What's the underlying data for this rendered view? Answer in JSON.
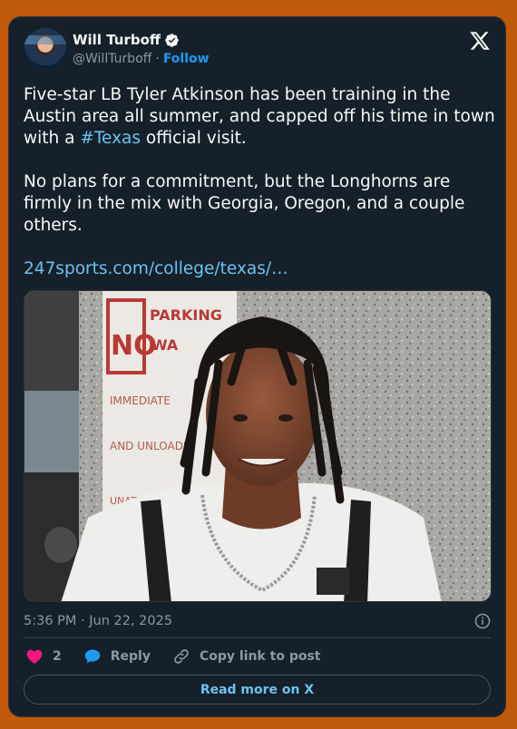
{
  "author": {
    "name": "Will Turboff",
    "handle": "@WillTurboff",
    "separator": "·",
    "follow_label": "Follow"
  },
  "tweet": {
    "para1_pre": "Five-star LB Tyler Atkinson has been training in the Austin area all summer, and capped off his time in town with a ",
    "hashtag": "#Texas",
    "para1_post": " official visit.",
    "para2": "No plans for a commitment, but the Longhorns are firmly in the mix with Georgia, Oregon, and a couple others.",
    "link": "247sports.com/college/texas/…"
  },
  "media": {
    "sign_text_1": "NO",
    "sign_text_2": "PARKING",
    "sign_text_3": "WA",
    "sign_text_4": "IMMEDIATE",
    "sign_text_5": "AND UNLOADIN",
    "sign_text_6": "UNATTENDED VE"
  },
  "meta": {
    "timestamp": "5:36 PM · Jun 22, 2025"
  },
  "actions": {
    "likes": "2",
    "reply_label": "Reply",
    "copy_label": "Copy link to post"
  },
  "readmore_label": "Read more on X",
  "colors": {
    "background": "#c05a0a",
    "card": "#15202b",
    "link": "#6cc3ee",
    "like": "#f91880",
    "reply": "#1d9bf0"
  },
  "icons": [
    "verified-icon",
    "x-logo-icon",
    "info-icon",
    "heart-icon",
    "reply-bubble-icon",
    "link-icon"
  ]
}
